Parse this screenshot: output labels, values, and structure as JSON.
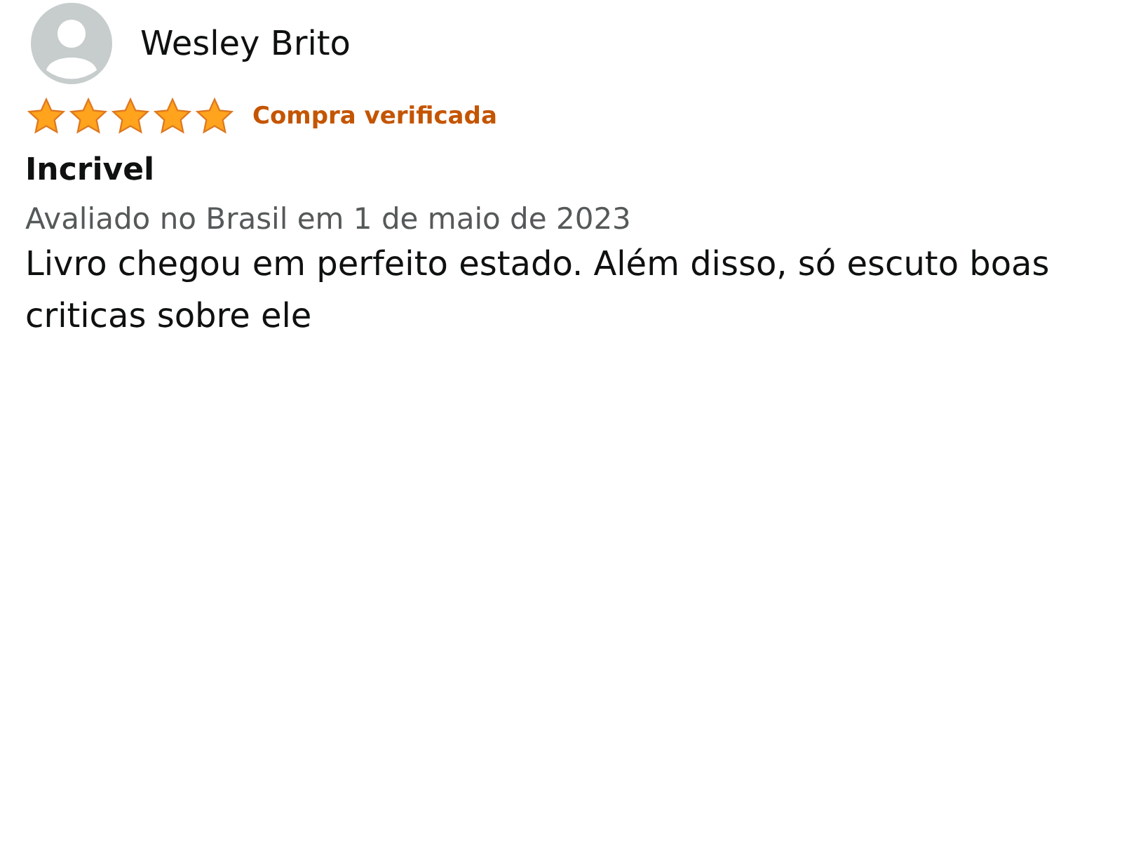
{
  "review": {
    "author": "Wesley Brito",
    "stars": 5,
    "badge": "Compra verificada",
    "title": "Incrivel",
    "date": "Avaliado no Brasil em 1 de maio de 2023",
    "body": "Livro chegou em perfeito estado. Além disso, só escuto boas criticas sobre ele"
  }
}
